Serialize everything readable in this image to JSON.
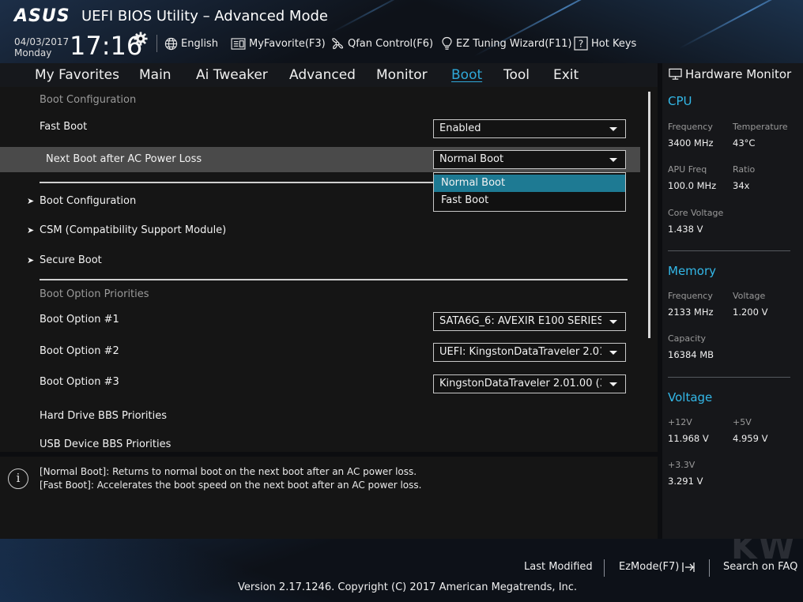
{
  "header": {
    "brand": "ASUS",
    "title": "UEFI BIOS Utility – Advanced Mode",
    "date": "04/03/2017",
    "day": "Monday",
    "time": "17:16",
    "language": "English",
    "my_favorite": "MyFavorite(F3)",
    "qfan": "Qfan Control(F6)",
    "ez_tuning": "EZ Tuning Wizard(F11)",
    "hot_keys": "Hot Keys"
  },
  "nav": {
    "tabs": [
      "My Favorites",
      "Main",
      "Ai Tweaker",
      "Advanced",
      "Monitor",
      "Boot",
      "Tool",
      "Exit"
    ],
    "active": "Boot"
  },
  "main": {
    "section_title": "Boot Configuration",
    "fast_boot": {
      "label": "Fast Boot",
      "value": "Enabled"
    },
    "next_boot": {
      "label": "Next Boot after AC Power Loss",
      "value": "Normal Boot"
    },
    "dropdown_options": [
      "Normal Boot",
      "Fast Boot"
    ],
    "dropdown_selected": "Normal Boot",
    "submenus": [
      "Boot Configuration",
      "CSM (Compatibility Support Module)",
      "Secure Boot"
    ],
    "priorities_title": "Boot Option Priorities",
    "boot_options": [
      {
        "label": "Boot Option #1",
        "value": "SATA6G_6: AVEXIR E100 SERIES ("
      },
      {
        "label": "Boot Option #2",
        "value": "UEFI: KingstonDataTraveler 2.01"
      },
      {
        "label": "Boot Option #3",
        "value": "KingstonDataTraveler 2.01.00 (3"
      }
    ],
    "hdd_bbs": "Hard Drive BBS Priorities",
    "usb_bbs": "USB Device BBS Priorities"
  },
  "help": {
    "line1": "[Normal Boot]: Returns to normal boot on the next boot after an AC power loss.",
    "line2": "[Fast Boot]: Accelerates the boot speed on the next boot after an AC power loss."
  },
  "hw_monitor": {
    "title": "Hardware Monitor",
    "cpu": {
      "title": "CPU",
      "frequency_label": "Frequency",
      "frequency": "3400 MHz",
      "temperature_label": "Temperature",
      "temperature": "43°C",
      "apu_label": "APU Freq",
      "apu": "100.0 MHz",
      "ratio_label": "Ratio",
      "ratio": "34x",
      "core_voltage_label": "Core Voltage",
      "core_voltage": "1.438 V"
    },
    "memory": {
      "title": "Memory",
      "frequency_label": "Frequency",
      "frequency": "2133 MHz",
      "voltage_label": "Voltage",
      "voltage": "1.200 V",
      "capacity_label": "Capacity",
      "capacity": "16384 MB"
    },
    "voltage": {
      "title": "Voltage",
      "v12_label": "+12V",
      "v12": "11.968 V",
      "v5_label": "+5V",
      "v5": "4.959 V",
      "v33_label": "+3.3V",
      "v33": "3.291 V"
    }
  },
  "footer": {
    "last_modified": "Last Modified",
    "ezmode": "EzMode(F7)",
    "search_faq": "Search on FAQ",
    "copyright": "Version 2.17.1246. Copyright (C) 2017 American Megatrends, Inc.",
    "watermark": "KW"
  },
  "colors": {
    "accent": "#2fa8d8",
    "section": "#33b8e8",
    "dropdown_selected": "#1e7a93",
    "highlight_row": "#4a4a4a"
  }
}
